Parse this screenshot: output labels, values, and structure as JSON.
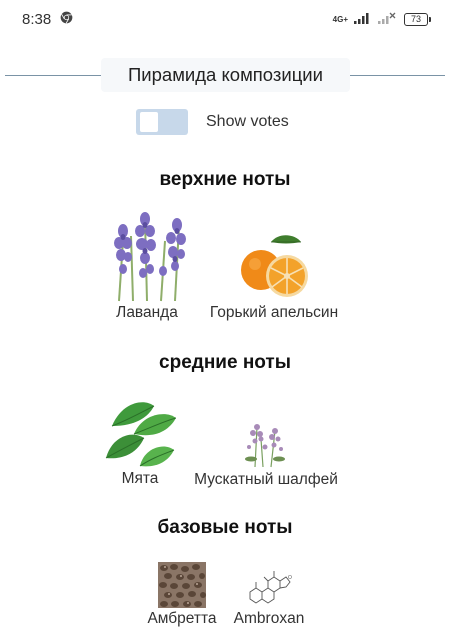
{
  "status": {
    "time": "8:38",
    "network": "4G+",
    "battery": "73"
  },
  "pyramid": {
    "title": "Пирамида композиции",
    "show_votes": {
      "label": "Show votes",
      "enabled": false
    },
    "groups": {
      "top": {
        "title": "верхние ноты",
        "notes": [
          {
            "name": "Лаванда",
            "icon": "lavender-image"
          },
          {
            "name": "Горький апельсин",
            "icon": "bitter-orange-image"
          }
        ]
      },
      "middle": {
        "title": "средние ноты",
        "notes": [
          {
            "name": "Мята",
            "icon": "mint-image"
          },
          {
            "name": "Мускатный шалфей",
            "icon": "clary-sage-image"
          }
        ]
      },
      "base": {
        "title": "базовые ноты",
        "notes": [
          {
            "name": "Амбретта",
            "icon": "ambrette-seeds-image"
          },
          {
            "name": "Ambroxan",
            "icon": "ambroxan-molecule-image"
          }
        ]
      }
    }
  }
}
